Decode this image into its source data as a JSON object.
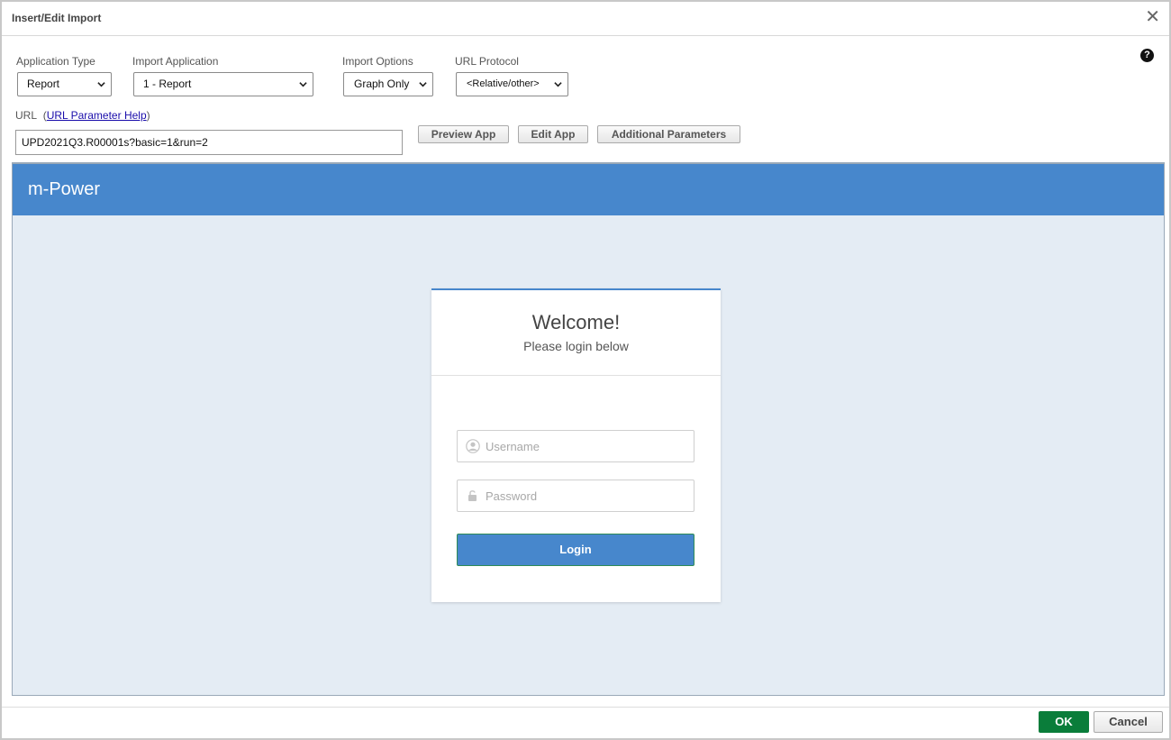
{
  "dialog": {
    "title": "Insert/Edit Import",
    "close_icon": "close-icon",
    "help_icon": "help-icon",
    "help_glyph": "?"
  },
  "form": {
    "application_type": {
      "label": "Application Type",
      "value": "Report"
    },
    "import_application": {
      "label": "Import Application",
      "value": "1 - Report"
    },
    "import_options": {
      "label": "Import Options",
      "value": "Graph Only"
    },
    "url_protocol": {
      "label": "URL Protocol",
      "value": "<Relative/other>"
    },
    "url": {
      "label": "URL",
      "help_link": "URL Parameter Help",
      "open_paren": "(",
      "close_paren": ")",
      "value": "UPD2021Q3.R00001s?basic=1&run=2"
    },
    "buttons": {
      "preview": "Preview App",
      "edit": "Edit App",
      "additional": "Additional Parameters"
    }
  },
  "preview": {
    "app_title": "m-Power",
    "welcome": "Welcome!",
    "subtitle": "Please login below",
    "username_placeholder": "Username",
    "password_placeholder": "Password",
    "login_label": "Login",
    "accent_color": "#4787cc"
  },
  "footer": {
    "ok_label": "OK",
    "cancel_label": "Cancel",
    "ok_color": "#0a7d3a"
  }
}
